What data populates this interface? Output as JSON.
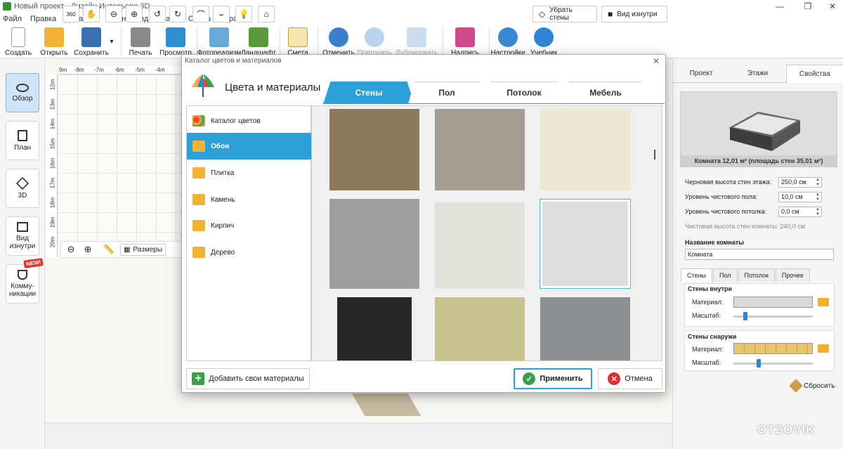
{
  "window": {
    "title": "Новый проект - Дизайн Интерьера 3D"
  },
  "menu": [
    "Файл",
    "Правка",
    "Добавить",
    "План",
    "Вид",
    "Этажи",
    "Смета",
    "Справка"
  ],
  "toolbar": {
    "create": "Создать",
    "open": "Открыть",
    "save": "Сохранить",
    "print": "Печать",
    "preview": "Просмотр",
    "photoreal": "Фотореализм",
    "landscape": "Ландшафт",
    "estimate": "Смета",
    "undo": "Отменить",
    "redo": "Повторить",
    "duplicate": "Дублировать",
    "label": "Надпись",
    "settings": "Настройки",
    "tutorial": "Учебник"
  },
  "left_panel": {
    "overview": "Обзор",
    "plan": "План",
    "3d": "3D",
    "inside_view_1": "Вид",
    "inside_view_2": "изнутри",
    "comm_1": "Комму-",
    "comm_2": "никации",
    "new_badge": "NEW!"
  },
  "rulers": {
    "top": [
      "9m",
      "-8m",
      "-7m",
      "-6m",
      "-5m",
      "-4m"
    ],
    "left": [
      "12m",
      "13m",
      "14m",
      "15m",
      "16m",
      "17m",
      "18m",
      "19m",
      "20m"
    ]
  },
  "canvas": {
    "dimensions_label": "Размеры"
  },
  "bottom_bar": {
    "remove_walls": "Убрать стены",
    "inside_view": "Вид изнутри",
    "rotate360": "360"
  },
  "right_panel": {
    "tabs": [
      "Проект",
      "Этажи",
      "Свойства"
    ],
    "preview_caption": "Комната 12,01 м²  (площадь стен 35,01 м²)",
    "props": [
      {
        "label": "Черновая высота стен этажа:",
        "value": "250,0 см"
      },
      {
        "label": "Уровень чистового пола:",
        "value": "10,0 см"
      },
      {
        "label": "Уровень чистового потолка:",
        "value": "0,0 см"
      }
    ],
    "clean_height": "Чистовая высота стен комнаты: 240,0 см",
    "room_name_title": "Название комнаты",
    "room_name_value": "Комната",
    "subtabs": [
      "Стены",
      "Пол",
      "Потолок",
      "Прочее"
    ],
    "walls_inside_title": "Стены внутри",
    "walls_outside_title": "Стены снаружи",
    "material_label": "Материал:",
    "scale_label": "Масштаб:",
    "scale_inside": 0.15,
    "scale_outside": 0.32,
    "reset": "Сбросить"
  },
  "watermark": "OTZOVIK",
  "dialog": {
    "window_title": "Каталог цветов и материалов",
    "header_title": "Цвета и материалы",
    "tabs": [
      "Стены",
      "Пол",
      "Потолок",
      "Мебель"
    ],
    "categories": [
      "Каталог цветов",
      "Обои",
      "Плитка",
      "Камень",
      "Кирпич",
      "Дерево"
    ],
    "add_button": "Добавить свои материалы",
    "apply_button": "Применить",
    "cancel_button": "Отмена",
    "tile_colors": [
      "#8d7a5c",
      "#a39d94",
      "#ede8d3",
      "#9e9e9e",
      "#e1e2d9",
      "#dedede",
      "#262626",
      "#c7c18d",
      "#8b9093"
    ],
    "selected_tile": 5
  }
}
